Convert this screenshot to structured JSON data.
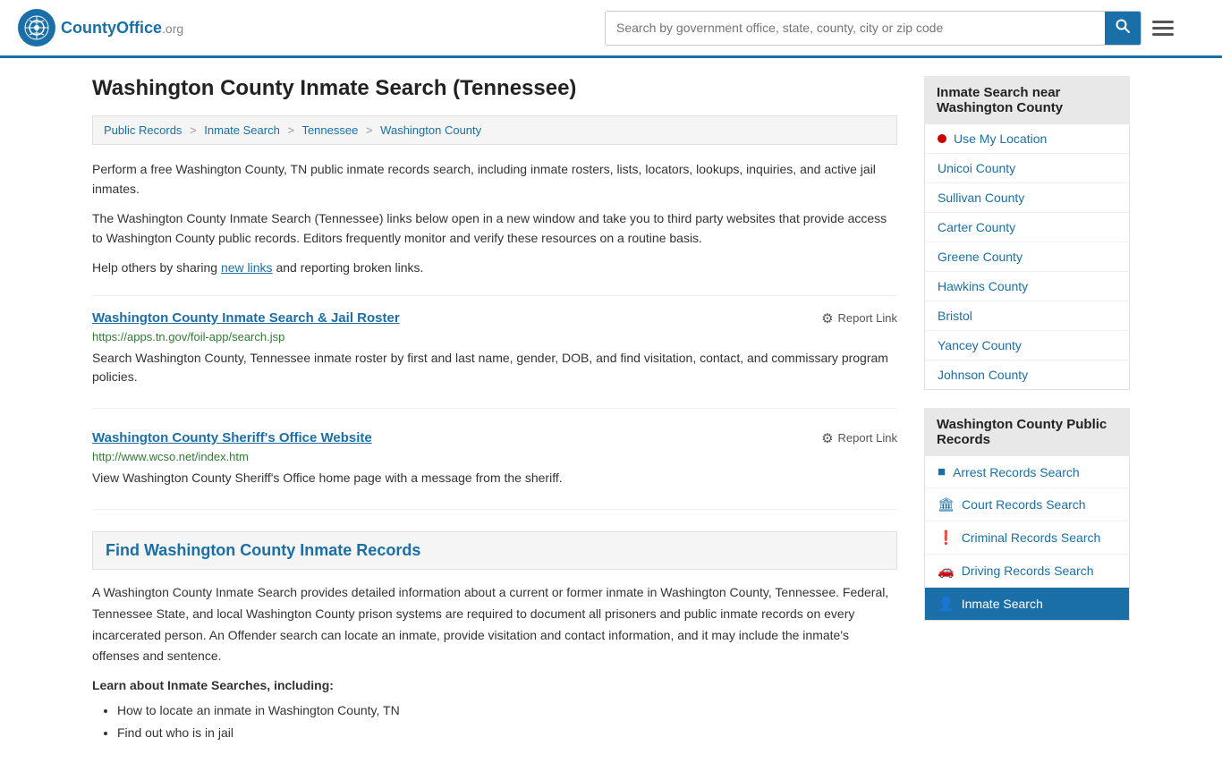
{
  "header": {
    "logo_letter": "🏛",
    "logo_brand": "CountyOffice",
    "logo_org": ".org",
    "search_placeholder": "Search by government office, state, county, city or zip code"
  },
  "page": {
    "title": "Washington County Inmate Search (Tennessee)",
    "breadcrumbs": [
      {
        "label": "Public Records",
        "href": "#"
      },
      {
        "label": "Inmate Search",
        "href": "#"
      },
      {
        "label": "Tennessee",
        "href": "#"
      },
      {
        "label": "Washington County",
        "href": "#"
      }
    ],
    "description1": "Perform a free Washington County, TN public inmate records search, including inmate rosters, lists, locators, lookups, inquiries, and active jail inmates.",
    "description2": "The Washington County Inmate Search (Tennessee) links below open in a new window and take you to third party websites that provide access to Washington County public records. Editors frequently monitor and verify these resources on a routine basis.",
    "description3_pre": "Help others by sharing ",
    "description3_link": "new links",
    "description3_post": " and reporting broken links.",
    "links": [
      {
        "title": "Washington County Inmate Search & Jail Roster",
        "url": "https://apps.tn.gov/foil-app/search.jsp",
        "desc": "Search Washington County, Tennessee inmate roster by first and last name, gender, DOB, and find visitation, contact, and commissary program policies."
      },
      {
        "title": "Washington County Sheriff's Office Website",
        "url": "http://www.wcso.net/index.htm",
        "desc": "View Washington County Sheriff's Office home page with a message from the sheriff."
      }
    ],
    "section_heading": "Find Washington County Inmate Records",
    "section_body": "A Washington County Inmate Search provides detailed information about a current or former inmate in Washington County, Tennessee. Federal, Tennessee State, and local Washington County prison systems are required to document all prisoners and public inmate records on every incarcerated person. An Offender search can locate an inmate, provide visitation and contact information, and it may include the inmate's offenses and sentence.",
    "learn_heading": "Learn about Inmate Searches, including:",
    "bullets": [
      "How to locate an inmate in Washington County, TN",
      "Find out who is in jail"
    ],
    "report_link_label": "Report Link"
  },
  "sidebar": {
    "nearby_heading": "Inmate Search near Washington County",
    "use_location_label": "Use My Location",
    "nearby_counties": [
      {
        "label": "Unicoi County"
      },
      {
        "label": "Sullivan County"
      },
      {
        "label": "Carter County"
      },
      {
        "label": "Greene County"
      },
      {
        "label": "Hawkins County"
      },
      {
        "label": "Bristol"
      },
      {
        "label": "Yancey County"
      },
      {
        "label": "Johnson County"
      }
    ],
    "public_records_heading": "Washington County Public Records",
    "public_records_links": [
      {
        "label": "Arrest Records Search",
        "icon": "■",
        "active": false
      },
      {
        "label": "Court Records Search",
        "icon": "🏛",
        "active": false
      },
      {
        "label": "Criminal Records Search",
        "icon": "!",
        "active": false
      },
      {
        "label": "Driving Records Search",
        "icon": "🚗",
        "active": false
      },
      {
        "label": "Inmate Search",
        "icon": "👤",
        "active": true
      }
    ]
  }
}
